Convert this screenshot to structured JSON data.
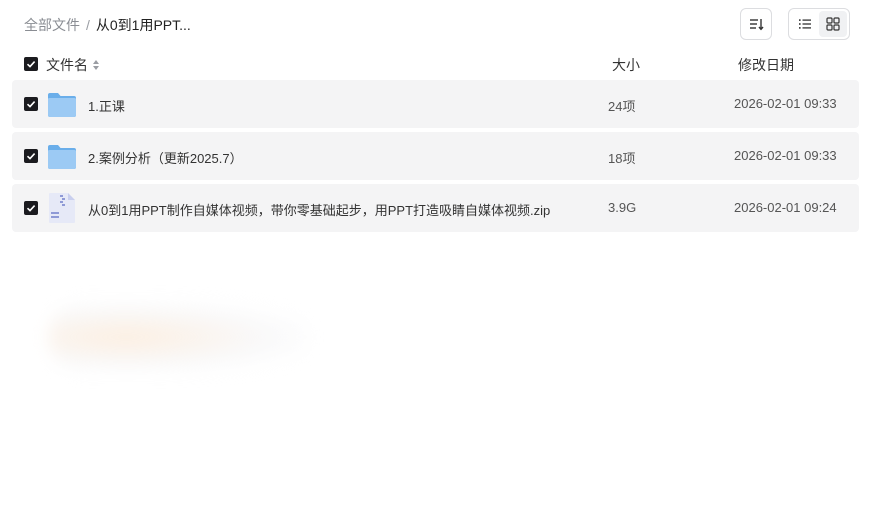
{
  "breadcrumb": {
    "root": "全部文件",
    "separator": "/",
    "current": "从0到1用PPT..."
  },
  "toolbar": {
    "sort_icon": "sort-icon",
    "list_view_icon": "list-view-icon",
    "grid_view_icon": "grid-view-icon"
  },
  "table": {
    "headers": {
      "name": "文件名",
      "size": "大小",
      "date": "修改日期"
    },
    "rows": [
      {
        "name": "1.正课",
        "size": "24项",
        "date": "2026-02-01 09:33",
        "type": "folder"
      },
      {
        "name": "2.案例分析（更新2025.7）",
        "size": "18项",
        "date": "2026-02-01 09:33",
        "type": "folder"
      },
      {
        "name": "从0到1用PPT制作自媒体视频，带你零基础起步，用PPT打造吸睛自媒体视频.zip",
        "size": "3.9G",
        "date": "2026-02-01 09:24",
        "type": "zip"
      }
    ]
  },
  "colors": {
    "row_bg": "#f4f4f5",
    "checkbox": "#1b1b1f",
    "folder": "#7dbaf0"
  }
}
